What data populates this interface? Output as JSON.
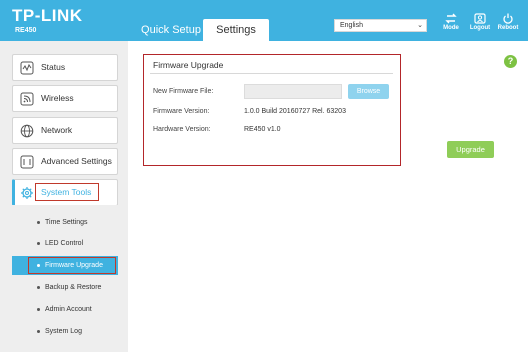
{
  "header": {
    "brand": "TP-LINK",
    "model": "RE450",
    "tabs": [
      {
        "label": "Quick Setup",
        "active": false
      },
      {
        "label": "Settings",
        "active": true
      }
    ],
    "language": "English",
    "buttons": [
      {
        "label": "Mode",
        "icon": "mode-arrows-icon"
      },
      {
        "label": "Logout",
        "icon": "logout-icon"
      },
      {
        "label": "Reboot",
        "icon": "reboot-icon"
      }
    ],
    "colors": {
      "bar": "#3fb2e0"
    }
  },
  "sidebar": {
    "items": [
      {
        "label": "Status",
        "icon": "status-icon"
      },
      {
        "label": "Wireless",
        "icon": "wireless-icon"
      },
      {
        "label": "Network",
        "icon": "network-globe-icon"
      },
      {
        "label": "Advanced Settings",
        "icon": "advanced-settings-icon"
      },
      {
        "label": "System Tools",
        "icon": "gear-icon",
        "active": true
      }
    ],
    "submenu": [
      {
        "label": "Time Settings"
      },
      {
        "label": "LED Control"
      },
      {
        "label": "Firmware Upgrade",
        "active": true
      },
      {
        "label": "Backup & Restore"
      },
      {
        "label": "Admin Account"
      },
      {
        "label": "System Log"
      }
    ]
  },
  "main": {
    "title": "Firmware Upgrade",
    "fields": {
      "new_firmware_label": "New Firmware File:",
      "new_firmware_value": "",
      "browse_label": "Browse",
      "firmware_version_label": "Firmware Version:",
      "firmware_version_value": "1.0.0 Build 20160727 Rel. 63203",
      "hardware_version_label": "Hardware Version:",
      "hardware_version_value": "RE450 v1.0"
    },
    "upgrade_label": "Upgrade",
    "help_symbol": "?",
    "colors": {
      "upgrade": "#8fcd58",
      "browse": "#8fd3ee",
      "highlight": "#b3262a"
    }
  }
}
